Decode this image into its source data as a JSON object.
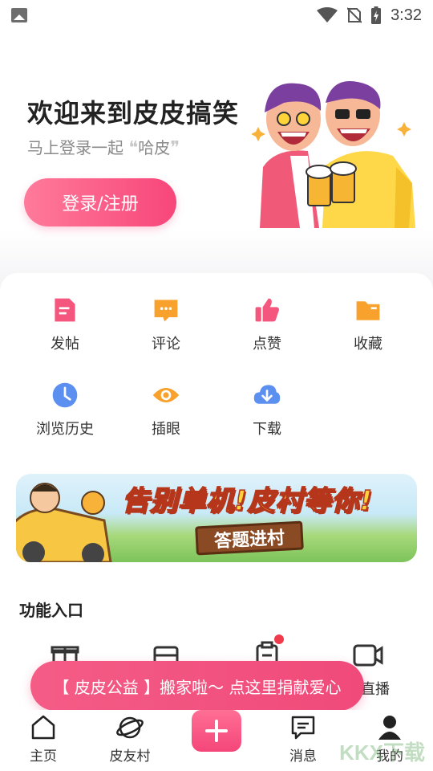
{
  "status_bar": {
    "time": "3:32"
  },
  "hero": {
    "title": "欢迎来到皮皮搞笑",
    "subtitle_prefix": "马上登录一起",
    "subtitle_quote_open": "❝",
    "subtitle_highlight": "哈皮",
    "subtitle_quote_close": "❞",
    "login_button": "登录/注册"
  },
  "grid": [
    {
      "label": "发帖",
      "icon": "post-icon",
      "color": "#f5567e"
    },
    {
      "label": "评论",
      "icon": "comment-icon",
      "color": "#f8a12c"
    },
    {
      "label": "点赞",
      "icon": "thumbs-up-icon",
      "color": "#f5567e"
    },
    {
      "label": "收藏",
      "icon": "folder-icon",
      "color": "#f8a12c"
    },
    {
      "label": "浏览历史",
      "icon": "clock-icon",
      "color": "#5b8ff0"
    },
    {
      "label": "插眼",
      "icon": "eye-icon",
      "color": "#f8a12c"
    },
    {
      "label": "下载",
      "icon": "download-icon",
      "color": "#5b8ff0"
    }
  ],
  "banner": {
    "headline": "告别单机!皮村等你!",
    "sign": "答题进村"
  },
  "features": {
    "title": "功能入口",
    "items": [
      {
        "label": "",
        "icon": "gift-icon"
      },
      {
        "label": "",
        "icon": "box-icon"
      },
      {
        "label": "",
        "icon": "clipboard-icon",
        "badge": true
      },
      {
        "label": "皮直播",
        "icon": "video-camera-icon"
      }
    ]
  },
  "toast": "【 皮皮公益 】搬家啦～ 点这里捐献爱心",
  "tabs": [
    {
      "label": "主页",
      "icon": "home-icon"
    },
    {
      "label": "皮友村",
      "icon": "planet-icon"
    },
    {
      "label": "",
      "icon": "plus-icon"
    },
    {
      "label": "消息",
      "icon": "message-icon"
    },
    {
      "label": "我的",
      "icon": "profile-icon"
    }
  ],
  "watermark": "KKX下载",
  "colors": {
    "accent": "#f4467a",
    "orange": "#f8a12c",
    "blue": "#5b8ff0"
  }
}
